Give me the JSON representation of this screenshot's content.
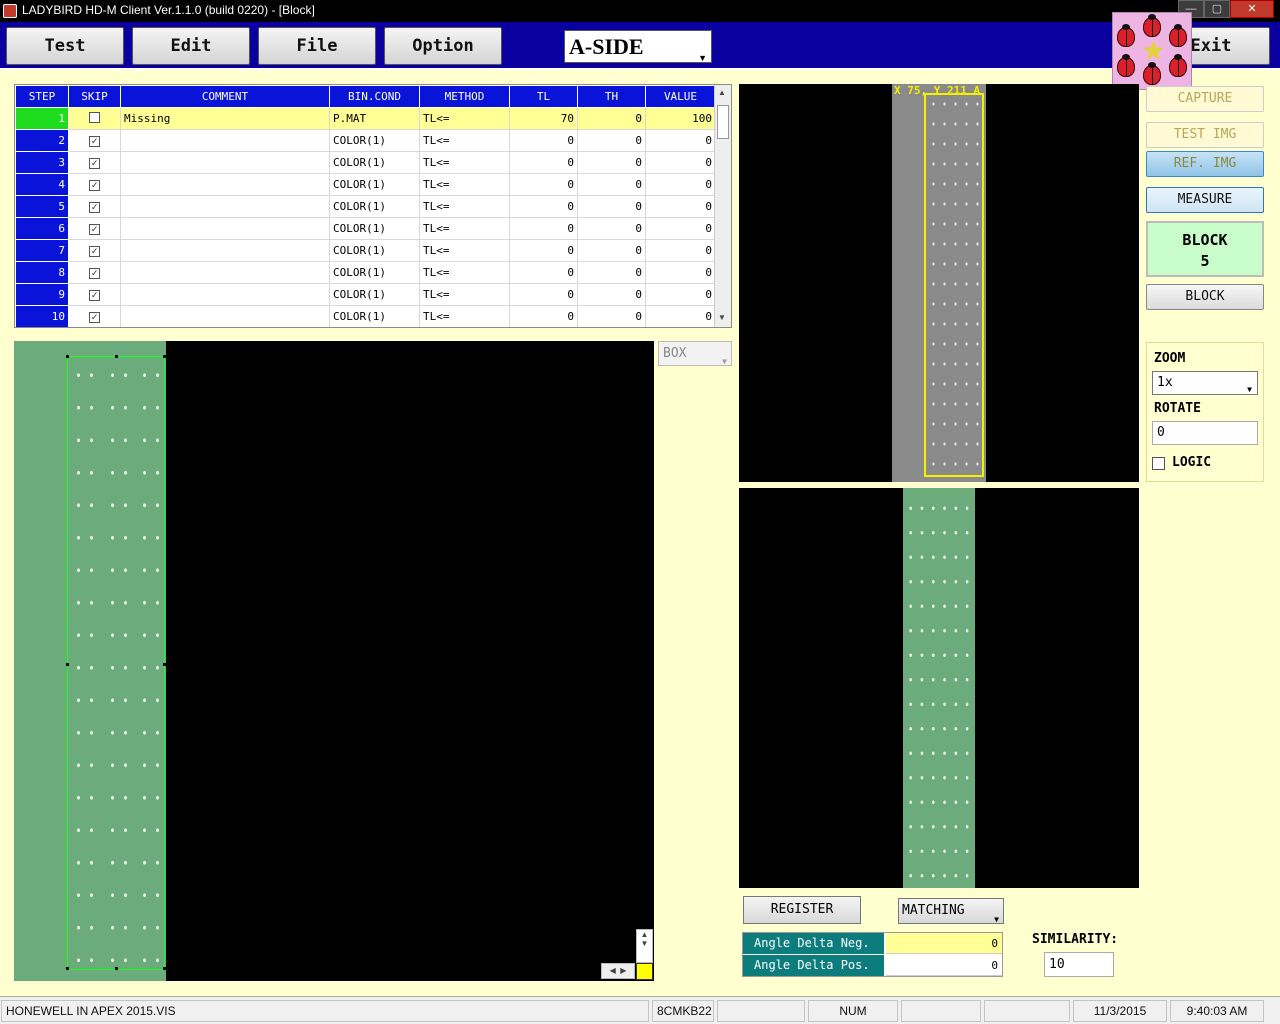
{
  "window": {
    "title": "LADYBIRD HD-M Client Ver.1.1.0  (build 0220) - [Block]",
    "minimize": "—",
    "maximize": "▢",
    "close": "✕"
  },
  "toolbar": {
    "test": "Test",
    "edit": "Edit",
    "file": "File",
    "option": "Option",
    "side_select": "A-SIDE",
    "exit": "Exit"
  },
  "grid": {
    "columns": [
      "STEP",
      "SKIP",
      "COMMENT",
      "BIN.COND",
      "METHOD",
      "TL",
      "TH",
      "VALUE"
    ],
    "rows": [
      {
        "step": "1",
        "skip": false,
        "comment": "Missing",
        "bin_cond": "P.MAT",
        "method": "TL<=",
        "tl": "70",
        "th": "0",
        "value": "100"
      },
      {
        "step": "2",
        "skip": true,
        "comment": "",
        "bin_cond": "COLOR(1)",
        "method": "TL<=",
        "tl": "0",
        "th": "0",
        "value": "0"
      },
      {
        "step": "3",
        "skip": true,
        "comment": "",
        "bin_cond": "COLOR(1)",
        "method": "TL<=",
        "tl": "0",
        "th": "0",
        "value": "0"
      },
      {
        "step": "4",
        "skip": true,
        "comment": "",
        "bin_cond": "COLOR(1)",
        "method": "TL<=",
        "tl": "0",
        "th": "0",
        "value": "0"
      },
      {
        "step": "5",
        "skip": true,
        "comment": "",
        "bin_cond": "COLOR(1)",
        "method": "TL<=",
        "tl": "0",
        "th": "0",
        "value": "0"
      },
      {
        "step": "6",
        "skip": true,
        "comment": "",
        "bin_cond": "COLOR(1)",
        "method": "TL<=",
        "tl": "0",
        "th": "0",
        "value": "0"
      },
      {
        "step": "7",
        "skip": true,
        "comment": "",
        "bin_cond": "COLOR(1)",
        "method": "TL<=",
        "tl": "0",
        "th": "0",
        "value": "0"
      },
      {
        "step": "8",
        "skip": true,
        "comment": "",
        "bin_cond": "COLOR(1)",
        "method": "TL<=",
        "tl": "0",
        "th": "0",
        "value": "0"
      },
      {
        "step": "9",
        "skip": true,
        "comment": "",
        "bin_cond": "COLOR(1)",
        "method": "TL<=",
        "tl": "0",
        "th": "0",
        "value": "0"
      },
      {
        "step": "10",
        "skip": true,
        "comment": "",
        "bin_cond": "COLOR(1)",
        "method": "TL<=",
        "tl": "0",
        "th": "0",
        "value": "0"
      }
    ]
  },
  "box_select": "BOX",
  "overlay_label": "X 75, Y 211 A",
  "right_panel": {
    "capture": "CAPTURE",
    "test_img": "TEST IMG",
    "ref_img": "REF. IMG",
    "measure": "MEASURE",
    "block_title": "BLOCK",
    "block_number": "5",
    "block_button": "BLOCK",
    "zoom_label": "ZOOM",
    "zoom_value": "1x",
    "rotate_label": "ROTATE",
    "rotate_value": "0",
    "logic_label": "LOGIC"
  },
  "register": {
    "register_button": "REGISTER",
    "matching_select": "MATCHING",
    "angle_neg_label": "Angle Delta Neg.",
    "angle_neg_value": "0",
    "angle_pos_label": "Angle Delta Pos.",
    "angle_pos_value": "0",
    "similarity_label": "SIMILARITY:",
    "similarity_value": "10"
  },
  "statusbar": {
    "file": "HONEWELL IN APEX 2015.VIS",
    "machine": "8CMKB22",
    "num": "NUM",
    "date": "11/3/2015",
    "time": "9:40:03 AM"
  },
  "colors": {
    "toolbar_bg": "#0a00a0",
    "grid_header": "#0a14d8",
    "active_row": "#ffff96",
    "active_step": "#1fdc1f",
    "pcb_green": "#6bab7c",
    "block_display": "#c8fcc8",
    "angle_label_bg": "#0d7c7c"
  }
}
